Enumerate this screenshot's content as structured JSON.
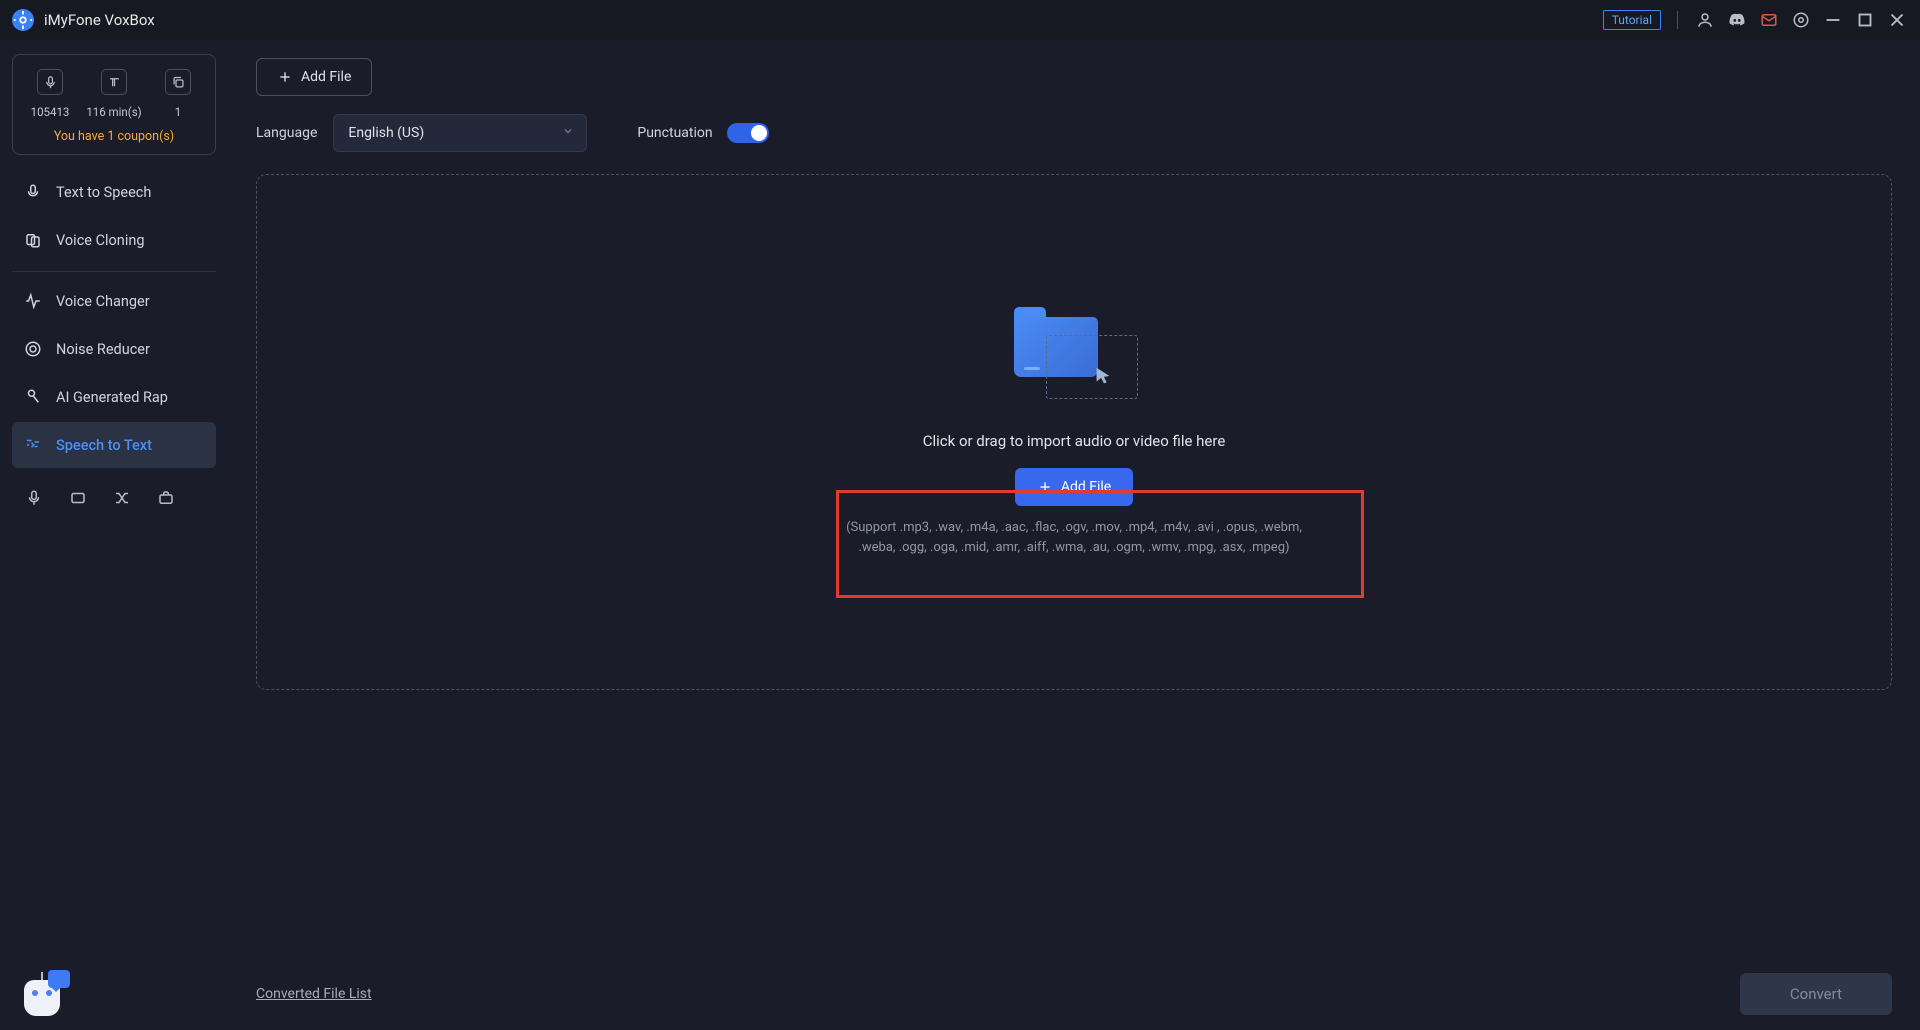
{
  "titlebar": {
    "app_name": "iMyFone VoxBox",
    "tutorial": "Tutorial"
  },
  "sidebar": {
    "stats": [
      {
        "value": "105413"
      },
      {
        "value": "116 min(s)"
      },
      {
        "value": "1"
      }
    ],
    "coupon": "You have 1 coupon(s)",
    "items": [
      {
        "label": "Text to Speech"
      },
      {
        "label": "Voice Cloning"
      },
      {
        "label": "Voice Changer"
      },
      {
        "label": "Noise Reducer"
      },
      {
        "label": "AI Generated Rap"
      },
      {
        "label": "Speech to Text"
      }
    ]
  },
  "toolbar": {
    "add_file": "Add File"
  },
  "controls": {
    "language_label": "Language",
    "language_value": "English (US)",
    "punctuation_label": "Punctuation"
  },
  "dropzone": {
    "prompt": "Click or drag to import audio or video file here",
    "add_file": "Add File",
    "formats": "(Support .mp3, .wav, .m4a, .aac, .flac, .ogv, .mov, .mp4, .m4v, .avi , .opus, .webm, .weba, .ogg, .oga, .mid, .amr, .aiff, .wma, .au, .ogm, .wmv, .mpg, .asx, .mpeg)"
  },
  "footer": {
    "converted_list": "Converted File List",
    "convert": "Convert"
  }
}
